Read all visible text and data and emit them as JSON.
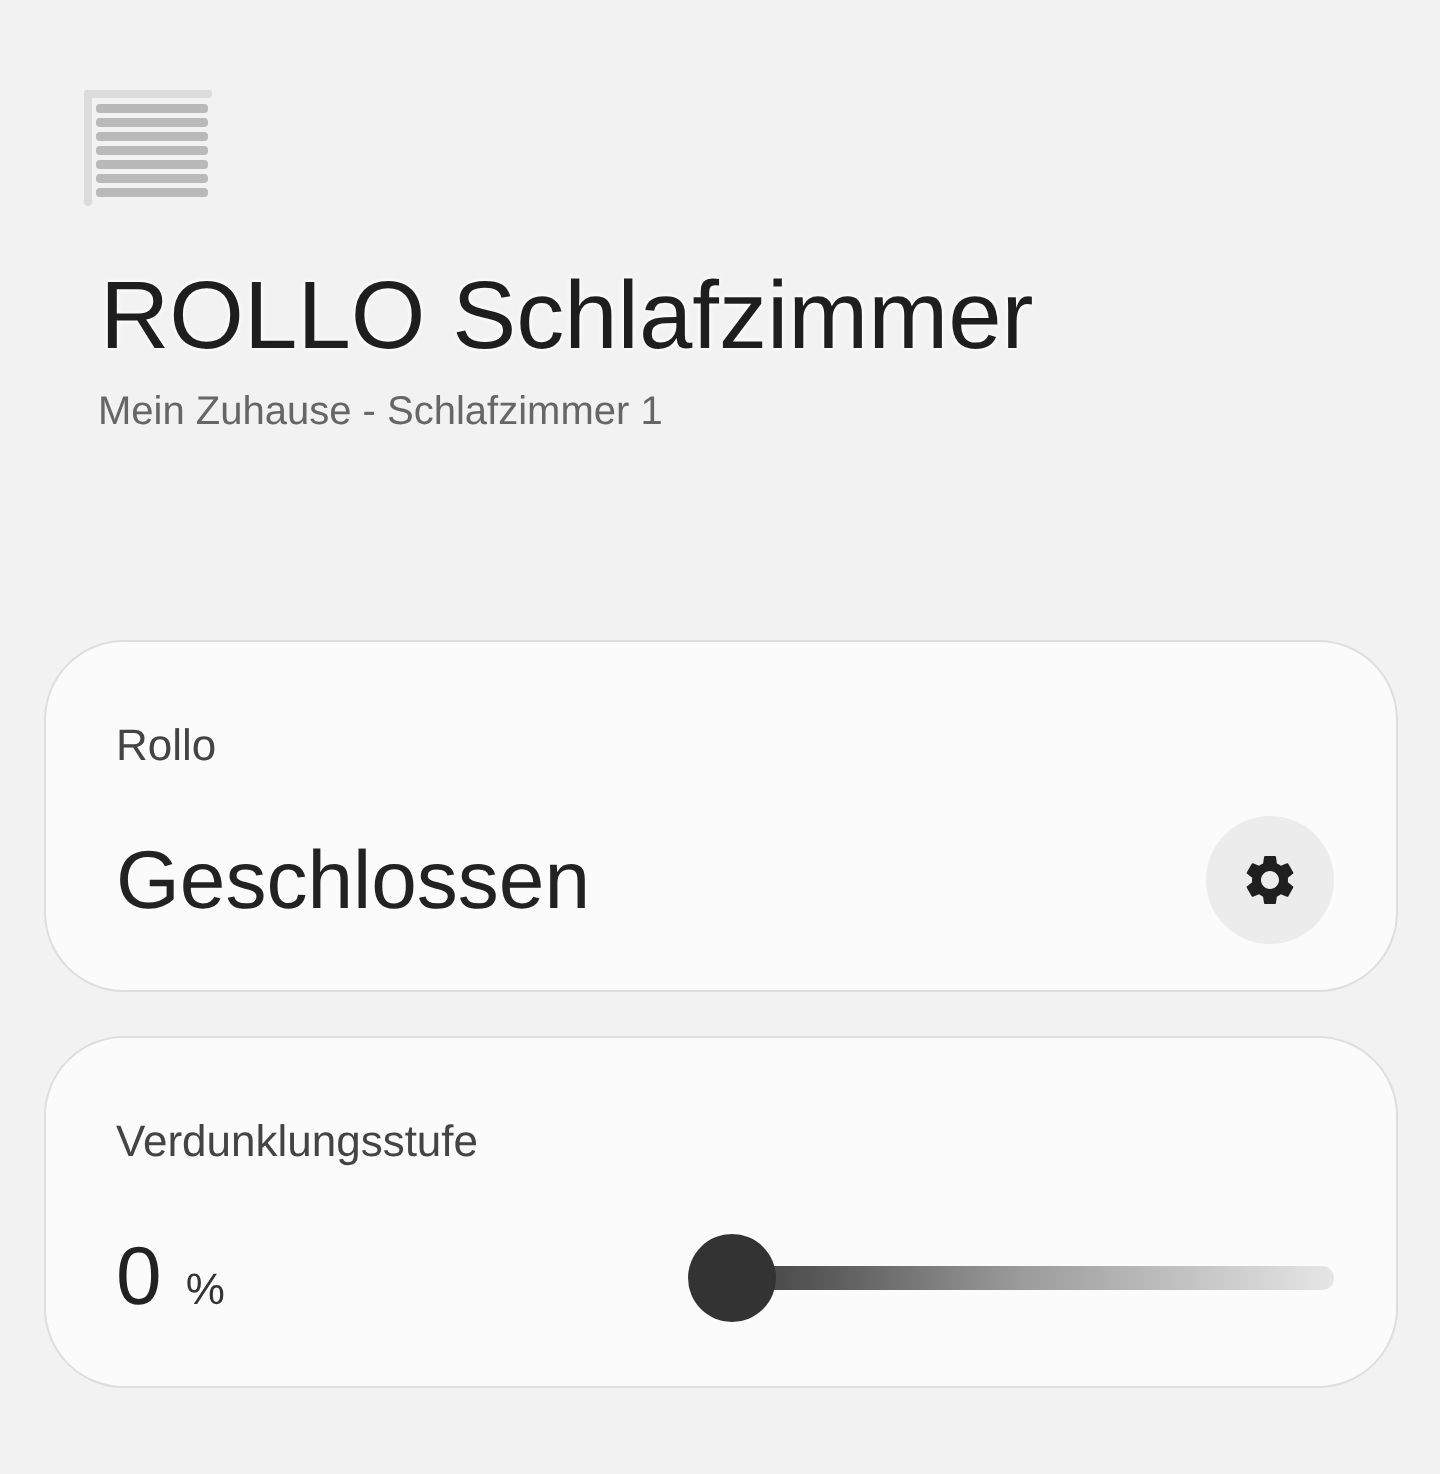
{
  "header": {
    "title": "ROLLO Schlafzimmer",
    "subtitle": "Mein Zuhause - Schlafzimmer 1"
  },
  "cards": [
    {
      "kind": "status",
      "label": "Rollo",
      "value": "Geschlossen"
    },
    {
      "kind": "slider",
      "label": "Verdunklungsstufe",
      "value": "0",
      "unit": "%",
      "level": 0
    }
  ]
}
